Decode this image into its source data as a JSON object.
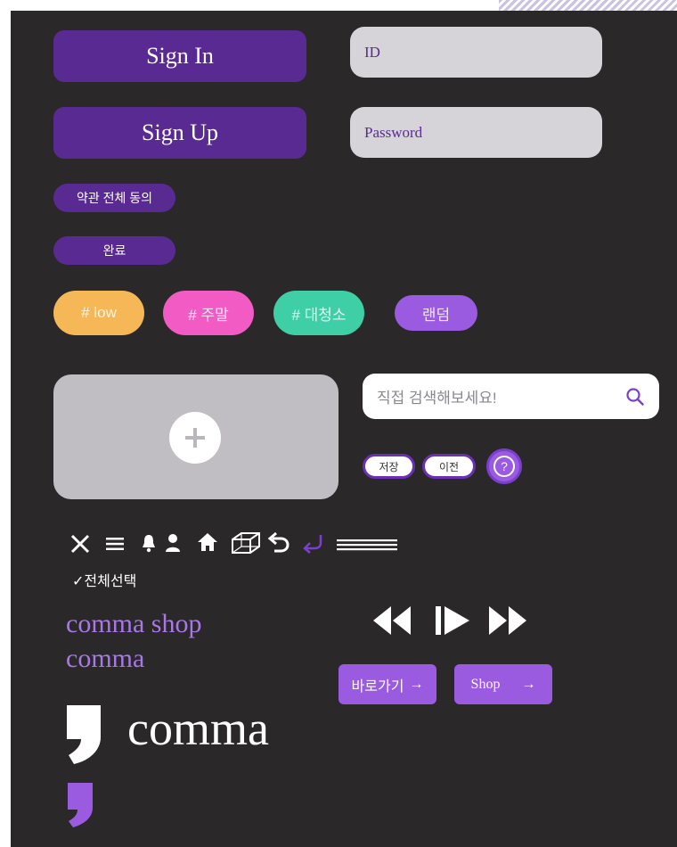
{
  "auth": {
    "sign_in_label": "Sign In",
    "sign_up_label": "Sign Up",
    "id_placeholder": "ID",
    "password_placeholder": "Password"
  },
  "terms": {
    "agree_all_label": "약관 전체 동의",
    "done_label": "완료"
  },
  "tags": [
    {
      "label": "# low",
      "color": "#f6b756"
    },
    {
      "label": "# 주말",
      "color": "#f25bc3"
    },
    {
      "label": "# 대청소",
      "color": "#3ecfa6"
    },
    {
      "label": "랜덤",
      "color": "#9a5be0"
    }
  ],
  "search": {
    "placeholder": "직접 검색해보세요!"
  },
  "small_buttons": {
    "save_label": "저장",
    "prev_label": "이전",
    "help_glyph": "?"
  },
  "icons_row": [
    "close-icon",
    "menu-icon",
    "bell-icon",
    "person-icon",
    "home-icon",
    "cube-icon",
    "undo-icon",
    "return-icon",
    "lines-icon"
  ],
  "select_all_label": "✓전체선택",
  "brand": {
    "text_1": "comma shop",
    "text_2": "comma",
    "logo_word": "comma"
  },
  "media_icons": [
    "rewind-icon",
    "play-icon",
    "fast-forward-icon"
  ],
  "actions": {
    "go_label": "바로가기",
    "shop_label": "Shop",
    "arrow": "→"
  },
  "colors": {
    "background": "#2a2828",
    "primary": "#5a2a93",
    "accent": "#9a5be0",
    "input_bg": "#d6d4d8"
  }
}
